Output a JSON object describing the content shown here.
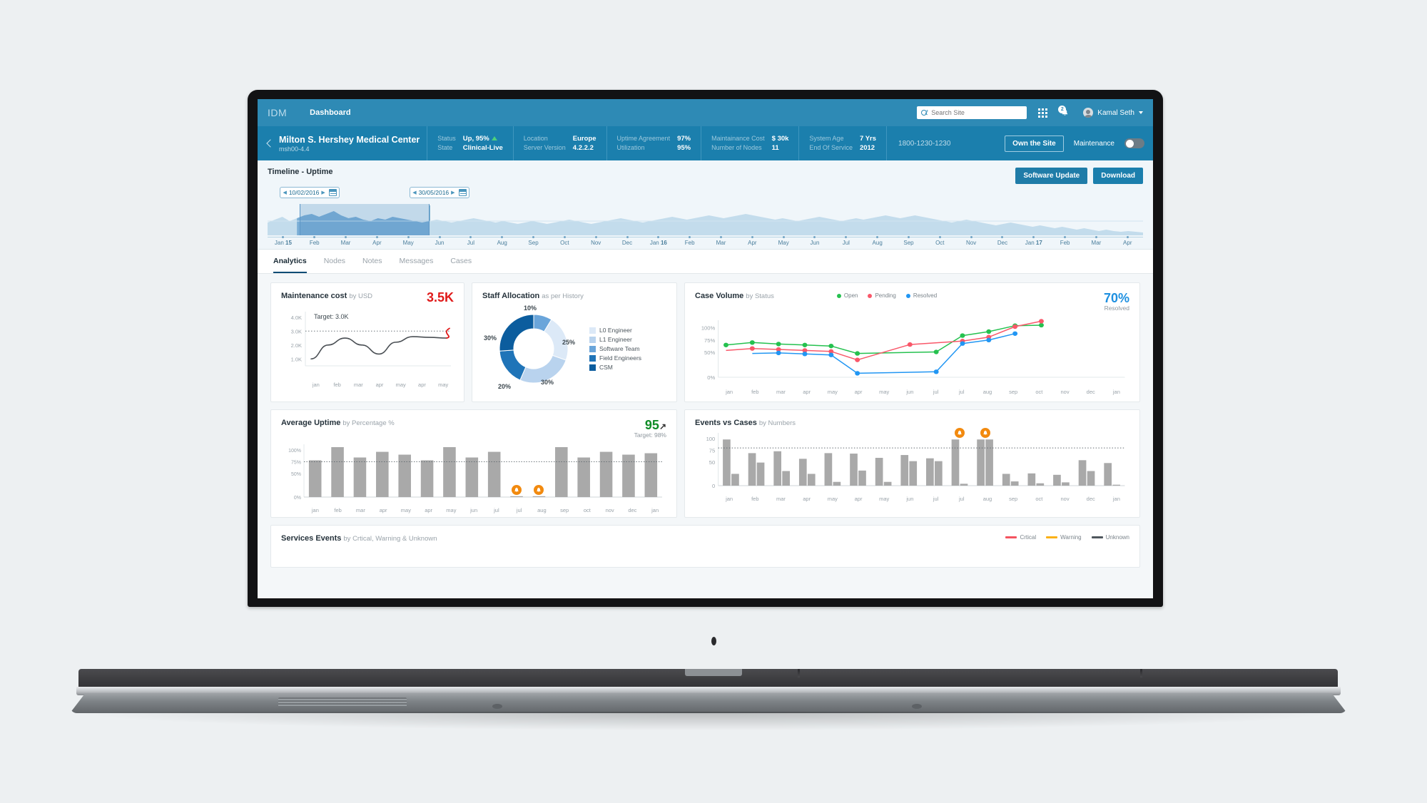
{
  "topnav": {
    "brand": "IDM",
    "nav_label": "Dashboard",
    "search_placeholder": "Search Site",
    "search_value": "",
    "notification_count": "2",
    "username": "Kamal Seth"
  },
  "sitebar": {
    "site_name": "Milton S. Hershey Medical Center",
    "site_id": "msh00-4.4",
    "fields": [
      {
        "key": "Status",
        "value": "Up, 95%",
        "trend": "up"
      },
      {
        "key": "State",
        "value": "Clinical-Live"
      },
      {
        "key": "Location",
        "value": "Europe"
      },
      {
        "key": "Server Version",
        "value": "4.2.2.2"
      },
      {
        "key": "Uptime Agreement",
        "value": "97%"
      },
      {
        "key": "Utilization",
        "value": "95%"
      },
      {
        "key": "Maintainance Cost",
        "value": "$ 30k"
      },
      {
        "key": "Number of Nodes",
        "value": "11"
      },
      {
        "key": "System Age",
        "value": "7 Yrs"
      },
      {
        "key": "End Of Service",
        "value": "2012"
      }
    ],
    "phone": "1800-1230-1230",
    "own_site_button": "Own the Site",
    "maintenance_label": "Maintenance",
    "maintenance_on": false
  },
  "timeline": {
    "title": "Timeline - Uptime",
    "software_update_button": "Software Update",
    "download_button": "Download",
    "date_from": "10/02/2016",
    "date_to": "30/05/2016",
    "ticks": [
      "Jan 15",
      "Feb",
      "Mar",
      "Apr",
      "May",
      "Jun",
      "Jul",
      "Aug",
      "Sep",
      "Oct",
      "Nov",
      "Dec",
      "Jan 16",
      "Feb",
      "Mar",
      "Apr",
      "May",
      "Jun",
      "Jul",
      "Aug",
      "Sep",
      "Oct",
      "Nov",
      "Dec",
      "Jan 17",
      "Feb",
      "Mar",
      "Apr"
    ],
    "selection_start_index": 1,
    "selection_end_index": 5
  },
  "tabs": [
    {
      "label": "Analytics",
      "active": true
    },
    {
      "label": "Nodes",
      "active": false
    },
    {
      "label": "Notes",
      "active": false
    },
    {
      "label": "Messages",
      "active": false
    },
    {
      "label": "Cases",
      "active": false
    }
  ],
  "chart_data": [
    {
      "id": "maintenance-cost",
      "type": "line",
      "title": "Maintenance cost",
      "subtitle": "by USD",
      "headline_value": "3.5K",
      "headline_color": "#e01a1a",
      "target_label": "Target: 3.0K",
      "target_value": 3.0,
      "ylabel": "",
      "ytick_labels": [
        "4.0K",
        "3.0K",
        "2.0K",
        "1.0K"
      ],
      "ylim": [
        0.5,
        4.4
      ],
      "categories": [
        "jan",
        "feb",
        "mar",
        "apr",
        "may",
        "apr",
        "may"
      ],
      "series": [
        {
          "name": "actual",
          "color": "#4a4f54",
          "values": [
            1.0,
            2.0,
            2.5,
            2.0,
            1.35,
            2.2,
            2.6,
            2.55,
            2.5
          ]
        },
        {
          "name": "forecast",
          "color": "#e01a1a",
          "values": [
            2.5,
            2.62,
            3.2
          ]
        }
      ]
    },
    {
      "id": "staff-allocation",
      "type": "pie",
      "title": "Staff Allocation",
      "subtitle": "as per History",
      "labels": [
        "L0 Engineer",
        "L1 Engineer",
        "Software Team",
        "Field Engineers",
        "CSM"
      ],
      "values": [
        25,
        30,
        10,
        20,
        30
      ],
      "display_labels": [
        "25%",
        "30%",
        "10%",
        "20%",
        "30%"
      ],
      "colors": [
        "#dce9f7",
        "#b9d3ee",
        "#6aa5da",
        "#1f74b8",
        "#0c5d9e"
      ],
      "slice_order": [
        "Software Team",
        "L0 Engineer",
        "L1 Engineer",
        "Field Engineers",
        "CSM"
      ],
      "legend_position": "right"
    },
    {
      "id": "case-volume",
      "type": "line",
      "title": "Case Volume",
      "subtitle": "by Status",
      "headline_value": "70%",
      "headline_sub": "Resolved",
      "headline_color": "#1e90e0",
      "ytick_labels": [
        "100%",
        "75%",
        "50%",
        "0%"
      ],
      "ylim": [
        0,
        115
      ],
      "categories": [
        "jan",
        "feb",
        "mar",
        "apr",
        "may",
        "apr",
        "may",
        "jun",
        "jul",
        "jul",
        "aug",
        "sep",
        "oct",
        "nov",
        "dec",
        "jan"
      ],
      "series": [
        {
          "name": "Open",
          "color": "#25c14f",
          "values": [
            65,
            70,
            67,
            65,
            63,
            48,
            null,
            null,
            51,
            84,
            92,
            104,
            105,
            null,
            null,
            null
          ]
        },
        {
          "name": "Pending",
          "color": "#f9586a",
          "values": [
            54,
            58,
            56,
            54,
            52,
            35,
            null,
            66,
            null,
            73,
            81,
            102,
            113,
            null,
            null,
            null
          ]
        },
        {
          "name": "Resolved",
          "color": "#2196f3",
          "values": [
            null,
            48,
            49,
            47,
            45,
            8,
            null,
            null,
            11,
            68,
            75,
            88,
            null,
            null,
            null,
            null
          ]
        }
      ],
      "legend": [
        {
          "label": "Open",
          "color": "#25c14f"
        },
        {
          "label": "Pending",
          "color": "#f9586a"
        },
        {
          "label": "Resolved",
          "color": "#2196f3"
        }
      ]
    },
    {
      "id": "average-uptime",
      "type": "bar",
      "title": "Average Uptime",
      "subtitle": "by Percentage %",
      "headline_value": "95",
      "headline_sub": "Target: 98%",
      "headline_color": "#0f8c27",
      "ytick_labels": [
        "100%",
        "75%",
        "50%",
        "0%"
      ],
      "ylim": [
        0,
        112
      ],
      "target_value": 75,
      "categories": [
        "jan",
        "feb",
        "mar",
        "apr",
        "may",
        "apr",
        "may",
        "jun",
        "jul",
        "jul",
        "aug",
        "sep",
        "oct",
        "nov",
        "dec",
        "jan"
      ],
      "values": [
        78,
        106,
        84,
        96,
        90,
        78,
        106,
        84,
        96,
        1,
        1,
        106,
        84,
        96,
        90,
        93
      ],
      "bar_color": "#a9a9a9",
      "alerts_at": [
        "jul",
        "aug"
      ]
    },
    {
      "id": "events-vs-cases",
      "type": "bar",
      "title": "Events vs Cases",
      "subtitle": "by Numbers",
      "ytick_labels": [
        "100",
        "75",
        "50",
        "0"
      ],
      "ylim": [
        0,
        112
      ],
      "target_value": 80,
      "categories": [
        "jan",
        "feb",
        "mar",
        "apr",
        "may",
        "apr",
        "may",
        "jun",
        "jul",
        "jul",
        "aug",
        "sep",
        "oct",
        "nov",
        "dec",
        "jan"
      ],
      "series": [
        {
          "name": "Events",
          "color": "#a9a9a9",
          "values": [
            98,
            69,
            73,
            57,
            69,
            68,
            59,
            65,
            58,
            98,
            98,
            25,
            26,
            23,
            54,
            48
          ]
        },
        {
          "name": "Cases",
          "color": "#a9a9a9",
          "values": [
            25,
            49,
            31,
            25,
            8,
            32,
            8,
            52,
            52,
            4,
            98,
            9,
            5,
            7,
            31,
            2
          ]
        }
      ],
      "alerts_at": [
        "jul",
        "aug"
      ]
    }
  ],
  "services_events": {
    "title": "Services Events",
    "subtitle": "by Crtical, Warning & Unknown",
    "legend": [
      {
        "label": "Crtical",
        "color": "#f4535f"
      },
      {
        "label": "Warning",
        "color": "#fbb117"
      },
      {
        "label": "Unknown",
        "color": "#4f575d"
      }
    ]
  }
}
